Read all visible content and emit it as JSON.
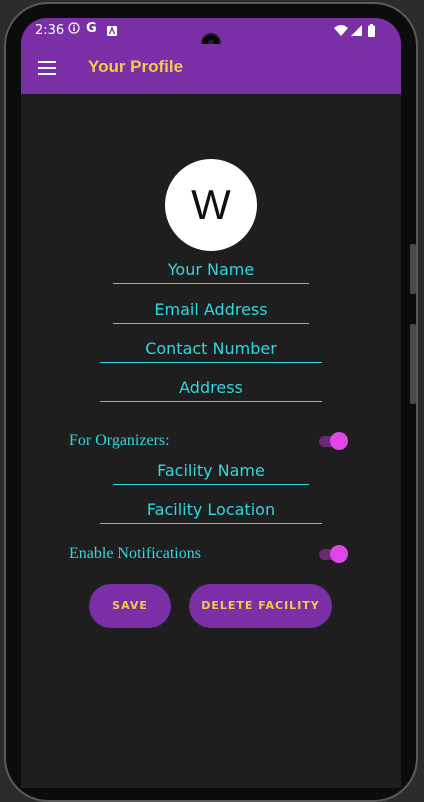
{
  "status": {
    "time": "2:36",
    "icons": [
      "info-icon",
      "google-icon",
      "app-icon",
      "wifi-icon",
      "signal-icon",
      "battery-icon"
    ]
  },
  "appbar": {
    "title": "Your Profile",
    "menu_icon": "hamburger-menu-icon"
  },
  "profile": {
    "avatar_letter": "W",
    "fields": {
      "name": "Your Name",
      "email": "Email Address",
      "contact": "Contact Number",
      "address": "Address"
    }
  },
  "organizer": {
    "label": "For Organizers:",
    "toggle_on": true,
    "fields": {
      "facility_name": "Facility Name",
      "facility_location": "Facility Location"
    }
  },
  "notifications": {
    "label": "Enable Notifications",
    "toggle_on": true
  },
  "buttons": {
    "save": "SAVE",
    "delete_facility": "DELETE FACILITY"
  },
  "colors": {
    "primary": "#7b2fa6",
    "accent_text": "#f7c948",
    "field_text": "#33d7df",
    "toggle_thumb": "#e046e7",
    "background": "#1e1e1e"
  }
}
